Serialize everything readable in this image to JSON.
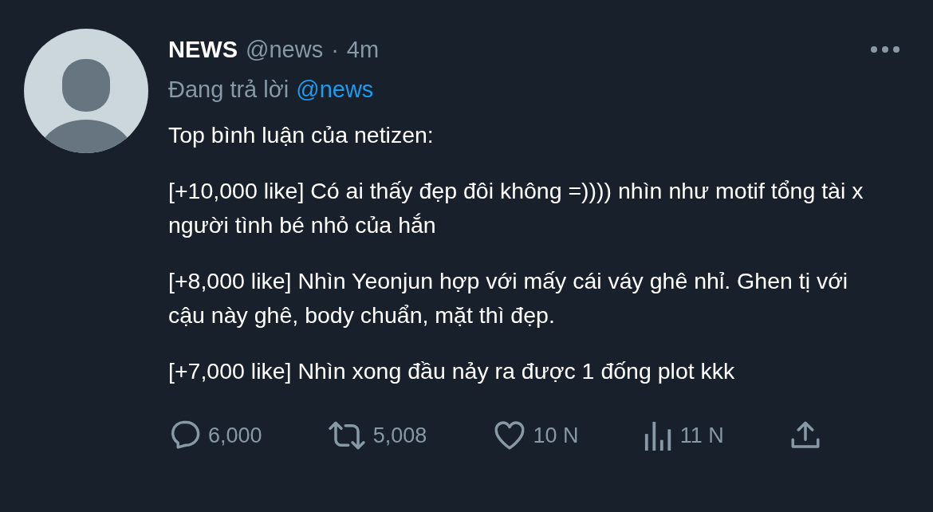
{
  "tweet": {
    "author_name": "NEWS",
    "handle": "@news",
    "separator": "·",
    "time": "4m",
    "reply_prefix": "Đang trả lời",
    "reply_to": "@news",
    "paragraphs": [
      "Top bình luận của netizen:",
      "[+10,000 like] Có ai thấy đẹp đôi không =)))) nhìn như motif tổng tài x người tình bé nhỏ của hắn",
      "[+8,000 like] Nhìn Yeonjun hợp với mấy cái váy ghê nhỉ. Ghen tị với cậu này ghê, body chuẩn, mặt thì đẹp.",
      "[+7,000 like] Nhìn xong đầu nảy ra được 1 đống plot kkk"
    ],
    "actions": [
      {
        "kind": "reply",
        "count": "6,000"
      },
      {
        "kind": "retweet",
        "count": "5,008"
      },
      {
        "kind": "like",
        "count": "10 N"
      },
      {
        "kind": "views",
        "count": "11 N"
      },
      {
        "kind": "share"
      }
    ]
  }
}
